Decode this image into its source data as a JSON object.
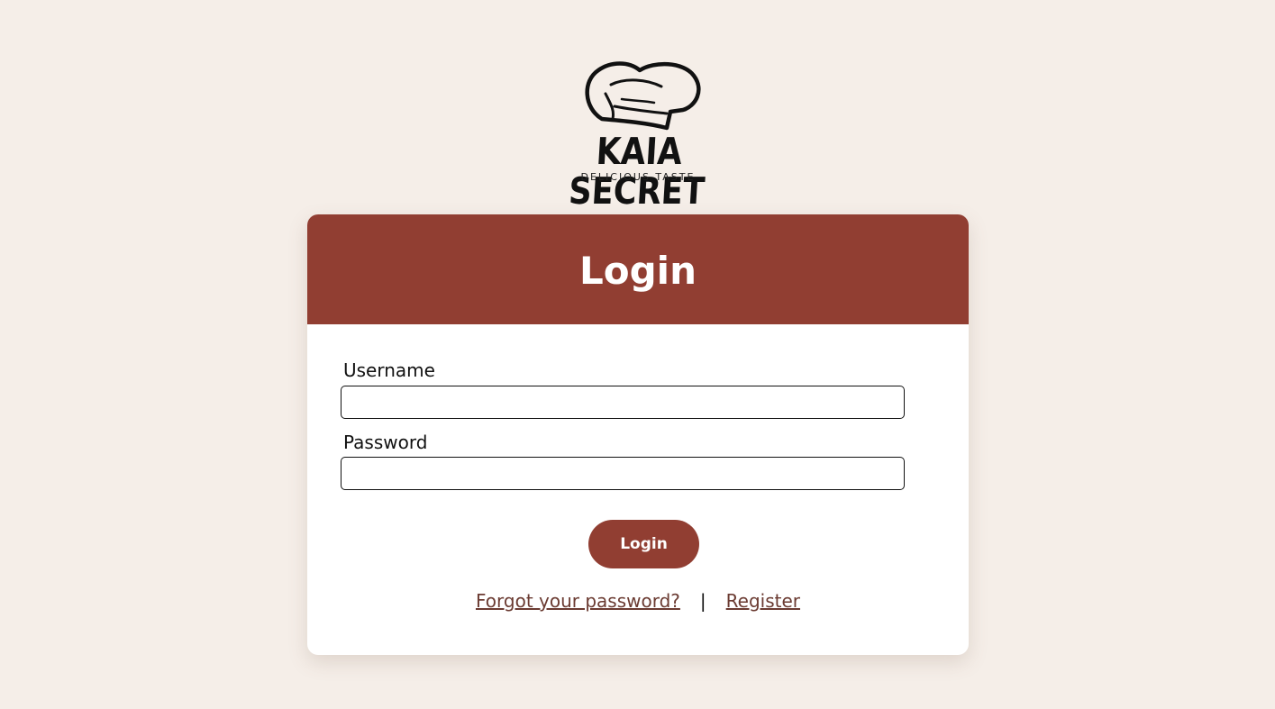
{
  "brand": {
    "name": "KAIA SECRET",
    "tagline": "DELICIOUS TASTE"
  },
  "icons": {
    "logo": "chef-hat-icon"
  },
  "colors": {
    "background": "#f5eee8",
    "accent": "#913e32",
    "link": "#6b3b32"
  },
  "login_card": {
    "title": "Login",
    "username": {
      "label": "Username",
      "value": "",
      "placeholder": ""
    },
    "password": {
      "label": "Password",
      "value": "",
      "placeholder": ""
    },
    "submit_label": "Login",
    "forgot_password_link": "Forgot your password?",
    "separator": "|",
    "register_link": "Register"
  }
}
